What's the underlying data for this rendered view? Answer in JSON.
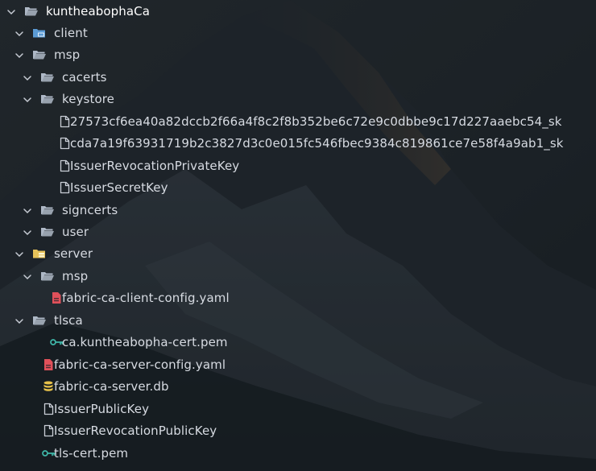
{
  "explorer": {
    "items": [
      {
        "label": "kuntheabophaCa",
        "depth": 0,
        "kind": "folder",
        "open": true,
        "icon": "folder-open-icon"
      },
      {
        "label": "client",
        "depth": 1,
        "kind": "folder",
        "open": true,
        "icon": "folder-client-icon"
      },
      {
        "label": "msp",
        "depth": 1,
        "kind": "folder",
        "open": true,
        "icon": "folder-open-icon"
      },
      {
        "label": "cacerts",
        "depth": 2,
        "kind": "folder",
        "open": true,
        "icon": "folder-open-icon"
      },
      {
        "label": "keystore",
        "depth": 2,
        "kind": "folder",
        "open": true,
        "icon": "folder-open-icon"
      },
      {
        "label": "27573cf6ea40a82dccb2f66a4f8c2f8b352be6c72e9c0dbbe9c17d227aaebc54_sk",
        "depth": 3,
        "kind": "file",
        "icon": "file-icon"
      },
      {
        "label": "cda7a19f63931719b2c3827d3c0e015fc546fbec9384c819861ce7e58f4a9ab1_sk",
        "depth": 3,
        "kind": "file",
        "icon": "file-icon"
      },
      {
        "label": "IssuerRevocationPrivateKey",
        "depth": 3,
        "kind": "file",
        "icon": "file-icon"
      },
      {
        "label": "IssuerSecretKey",
        "depth": 3,
        "kind": "file",
        "icon": "file-icon"
      },
      {
        "label": "signcerts",
        "depth": 2,
        "kind": "folder",
        "open": true,
        "icon": "folder-open-icon"
      },
      {
        "label": "user",
        "depth": 2,
        "kind": "folder",
        "open": true,
        "icon": "folder-open-icon"
      },
      {
        "label": "server",
        "depth": 1,
        "kind": "folder",
        "open": true,
        "icon": "folder-server-icon"
      },
      {
        "label": "msp",
        "depth": 2,
        "kind": "folder",
        "open": true,
        "icon": "folder-open-icon"
      },
      {
        "label": "fabric-ca-client-config.yaml",
        "depth": 2,
        "kind": "file",
        "icon": "yaml-file-icon"
      },
      {
        "label": "tlsca",
        "depth": 1,
        "kind": "folder",
        "open": true,
        "icon": "folder-open-icon"
      },
      {
        "label": "ca.kuntheabopha-cert.pem",
        "depth": 2,
        "kind": "file",
        "icon": "key-icon"
      },
      {
        "label": "fabric-ca-server-config.yaml",
        "depth": 1,
        "kind": "file",
        "icon": "yaml-file-icon"
      },
      {
        "label": "fabric-ca-server.db",
        "depth": 1,
        "kind": "file",
        "icon": "database-icon"
      },
      {
        "label": "IssuerPublicKey",
        "depth": 1,
        "kind": "file",
        "icon": "file-icon"
      },
      {
        "label": "IssuerRevocationPublicKey",
        "depth": 1,
        "kind": "file",
        "icon": "file-icon"
      },
      {
        "label": "tls-cert.pem",
        "depth": 1,
        "kind": "file",
        "icon": "key-icon"
      }
    ]
  },
  "colors": {
    "folder": "#aeb8c6",
    "client_folder": "#5b9bd5",
    "server_folder": "#e7c35a",
    "yaml": "#e0505a",
    "database": "#e8c24a",
    "key": "#3fb6a8",
    "file": "#c9ced6",
    "twisty": "#c7ccd4"
  }
}
